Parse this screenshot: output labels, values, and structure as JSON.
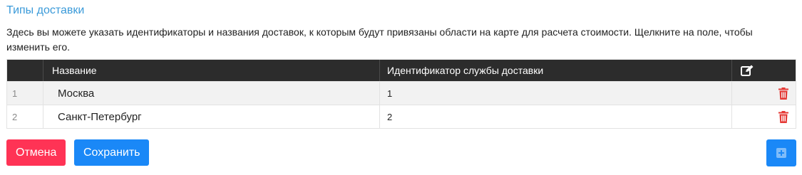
{
  "title": "Типы доставки",
  "description": "Здесь вы можете указать идентификаторы и названия доставок, к которым будут привязаны области на карте для расчета стоимости. Щелкните на поле, чтобы изменить его.",
  "table": {
    "headers": {
      "number": "",
      "name": "Название",
      "service_id": "Идентификатор службы доставки",
      "actions_icon": "edit-icon"
    },
    "rows": [
      {
        "number": "1",
        "name": "Москва",
        "service_id": "1",
        "delete_icon": "trash-icon"
      },
      {
        "number": "2",
        "name": "Санкт-Петербург",
        "service_id": "2",
        "delete_icon": "trash-icon"
      }
    ]
  },
  "buttons": {
    "cancel_label": "Отмена",
    "save_label": "Сохранить",
    "add_icon": "plus-square-icon"
  },
  "colors": {
    "title": "#3a9ad9",
    "header_bg": "#2c2c2c",
    "cancel": "#ff3355",
    "primary": "#1a88f7",
    "delete": "#e53935"
  }
}
